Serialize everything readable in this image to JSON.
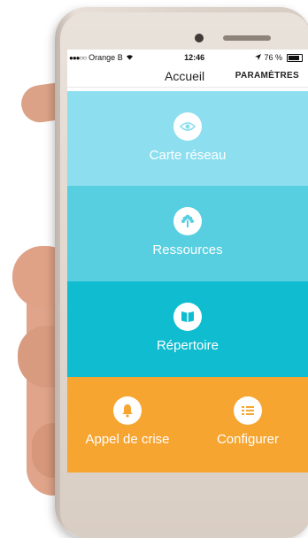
{
  "statusbar": {
    "carrier": "Orange B",
    "time": "12:46",
    "battery": "76 %"
  },
  "navbar": {
    "title": "Accueil",
    "settings": "PARAMÈTRES"
  },
  "tiles": [
    {
      "label": "Carte réseau",
      "icon": "eye-icon",
      "color": "#8ddff0"
    },
    {
      "label": "Ressources",
      "icon": "tree-icon",
      "color": "#57cfe0"
    },
    {
      "label": "Répertoire",
      "icon": "book-icon",
      "color": "#10bccf"
    }
  ],
  "bottom_row": {
    "color": "#f7a531",
    "left": {
      "label": "Appel de crise",
      "icon": "bell-icon"
    },
    "right": {
      "label": "Configurer",
      "icon": "list-icon"
    }
  }
}
